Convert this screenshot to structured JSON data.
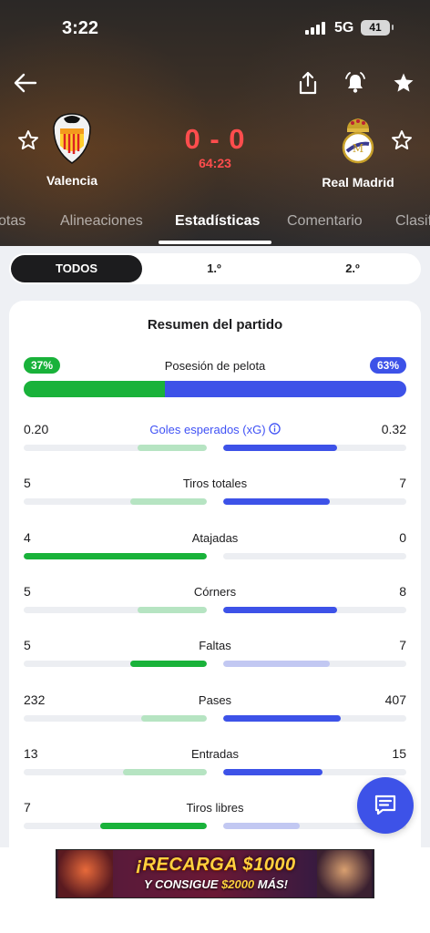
{
  "status_bar": {
    "time": "3:22",
    "network": "5G",
    "battery": "41"
  },
  "match": {
    "home": {
      "name": "Valencia"
    },
    "away": {
      "name": "Real Madrid"
    },
    "score": "0 - 0",
    "minute": "64:23"
  },
  "tabs": [
    "otas",
    "Alineaciones",
    "Estadísticas",
    "Comentario",
    "Clasif"
  ],
  "active_tab": "Estadísticas",
  "periods": [
    "TODOS",
    "1.º",
    "2.º"
  ],
  "active_period": "TODOS",
  "summary": {
    "title": "Resumen del partido",
    "possession": {
      "label": "Posesión de pelota",
      "home": "37%",
      "away": "63%",
      "home_fraction": 0.37
    },
    "stats": [
      {
        "label": "Goles esperados (xG)",
        "home": "0.20",
        "away": "0.32",
        "home_fill": 0.38,
        "away_fill": 0.62,
        "leader": "away",
        "link": true
      },
      {
        "label": "Tiros totales",
        "home": "5",
        "away": "7",
        "home_fill": 0.42,
        "away_fill": 0.58,
        "leader": "away"
      },
      {
        "label": "Atajadas",
        "home": "4",
        "away": "0",
        "home_fill": 1.0,
        "away_fill": 0.0,
        "leader": "home"
      },
      {
        "label": "Córners",
        "home": "5",
        "away": "8",
        "home_fill": 0.38,
        "away_fill": 0.62,
        "leader": "away"
      },
      {
        "label": "Faltas",
        "home": "5",
        "away": "7",
        "home_fill": 0.42,
        "away_fill": 0.58,
        "leader": "home"
      },
      {
        "label": "Pases",
        "home": "232",
        "away": "407",
        "home_fill": 0.36,
        "away_fill": 0.64,
        "leader": "away"
      },
      {
        "label": "Entradas",
        "home": "13",
        "away": "15",
        "home_fill": 0.46,
        "away_fill": 0.54,
        "leader": "away"
      },
      {
        "label": "Tiros libres",
        "home": "7",
        "away": "",
        "home_fill": 0.58,
        "away_fill": 0.42,
        "leader": "home"
      }
    ]
  },
  "ad": {
    "line1": "¡RECARGA $1000",
    "line2_prefix": "Y CONSIGUE ",
    "line2_amount": "$2000",
    "line2_suffix": " MÁS!"
  },
  "colors": {
    "home_strong": "#19b23a",
    "home_light": "#b6e4c2",
    "away_strong": "#3d52e8",
    "away_light": "#c2c8f2",
    "score": "#ff4d4d"
  },
  "icons": [
    "back-arrow-icon",
    "share-icon",
    "bell-alert-icon",
    "star-filled-icon",
    "star-outline-icon",
    "info-icon",
    "chat-icon"
  ]
}
